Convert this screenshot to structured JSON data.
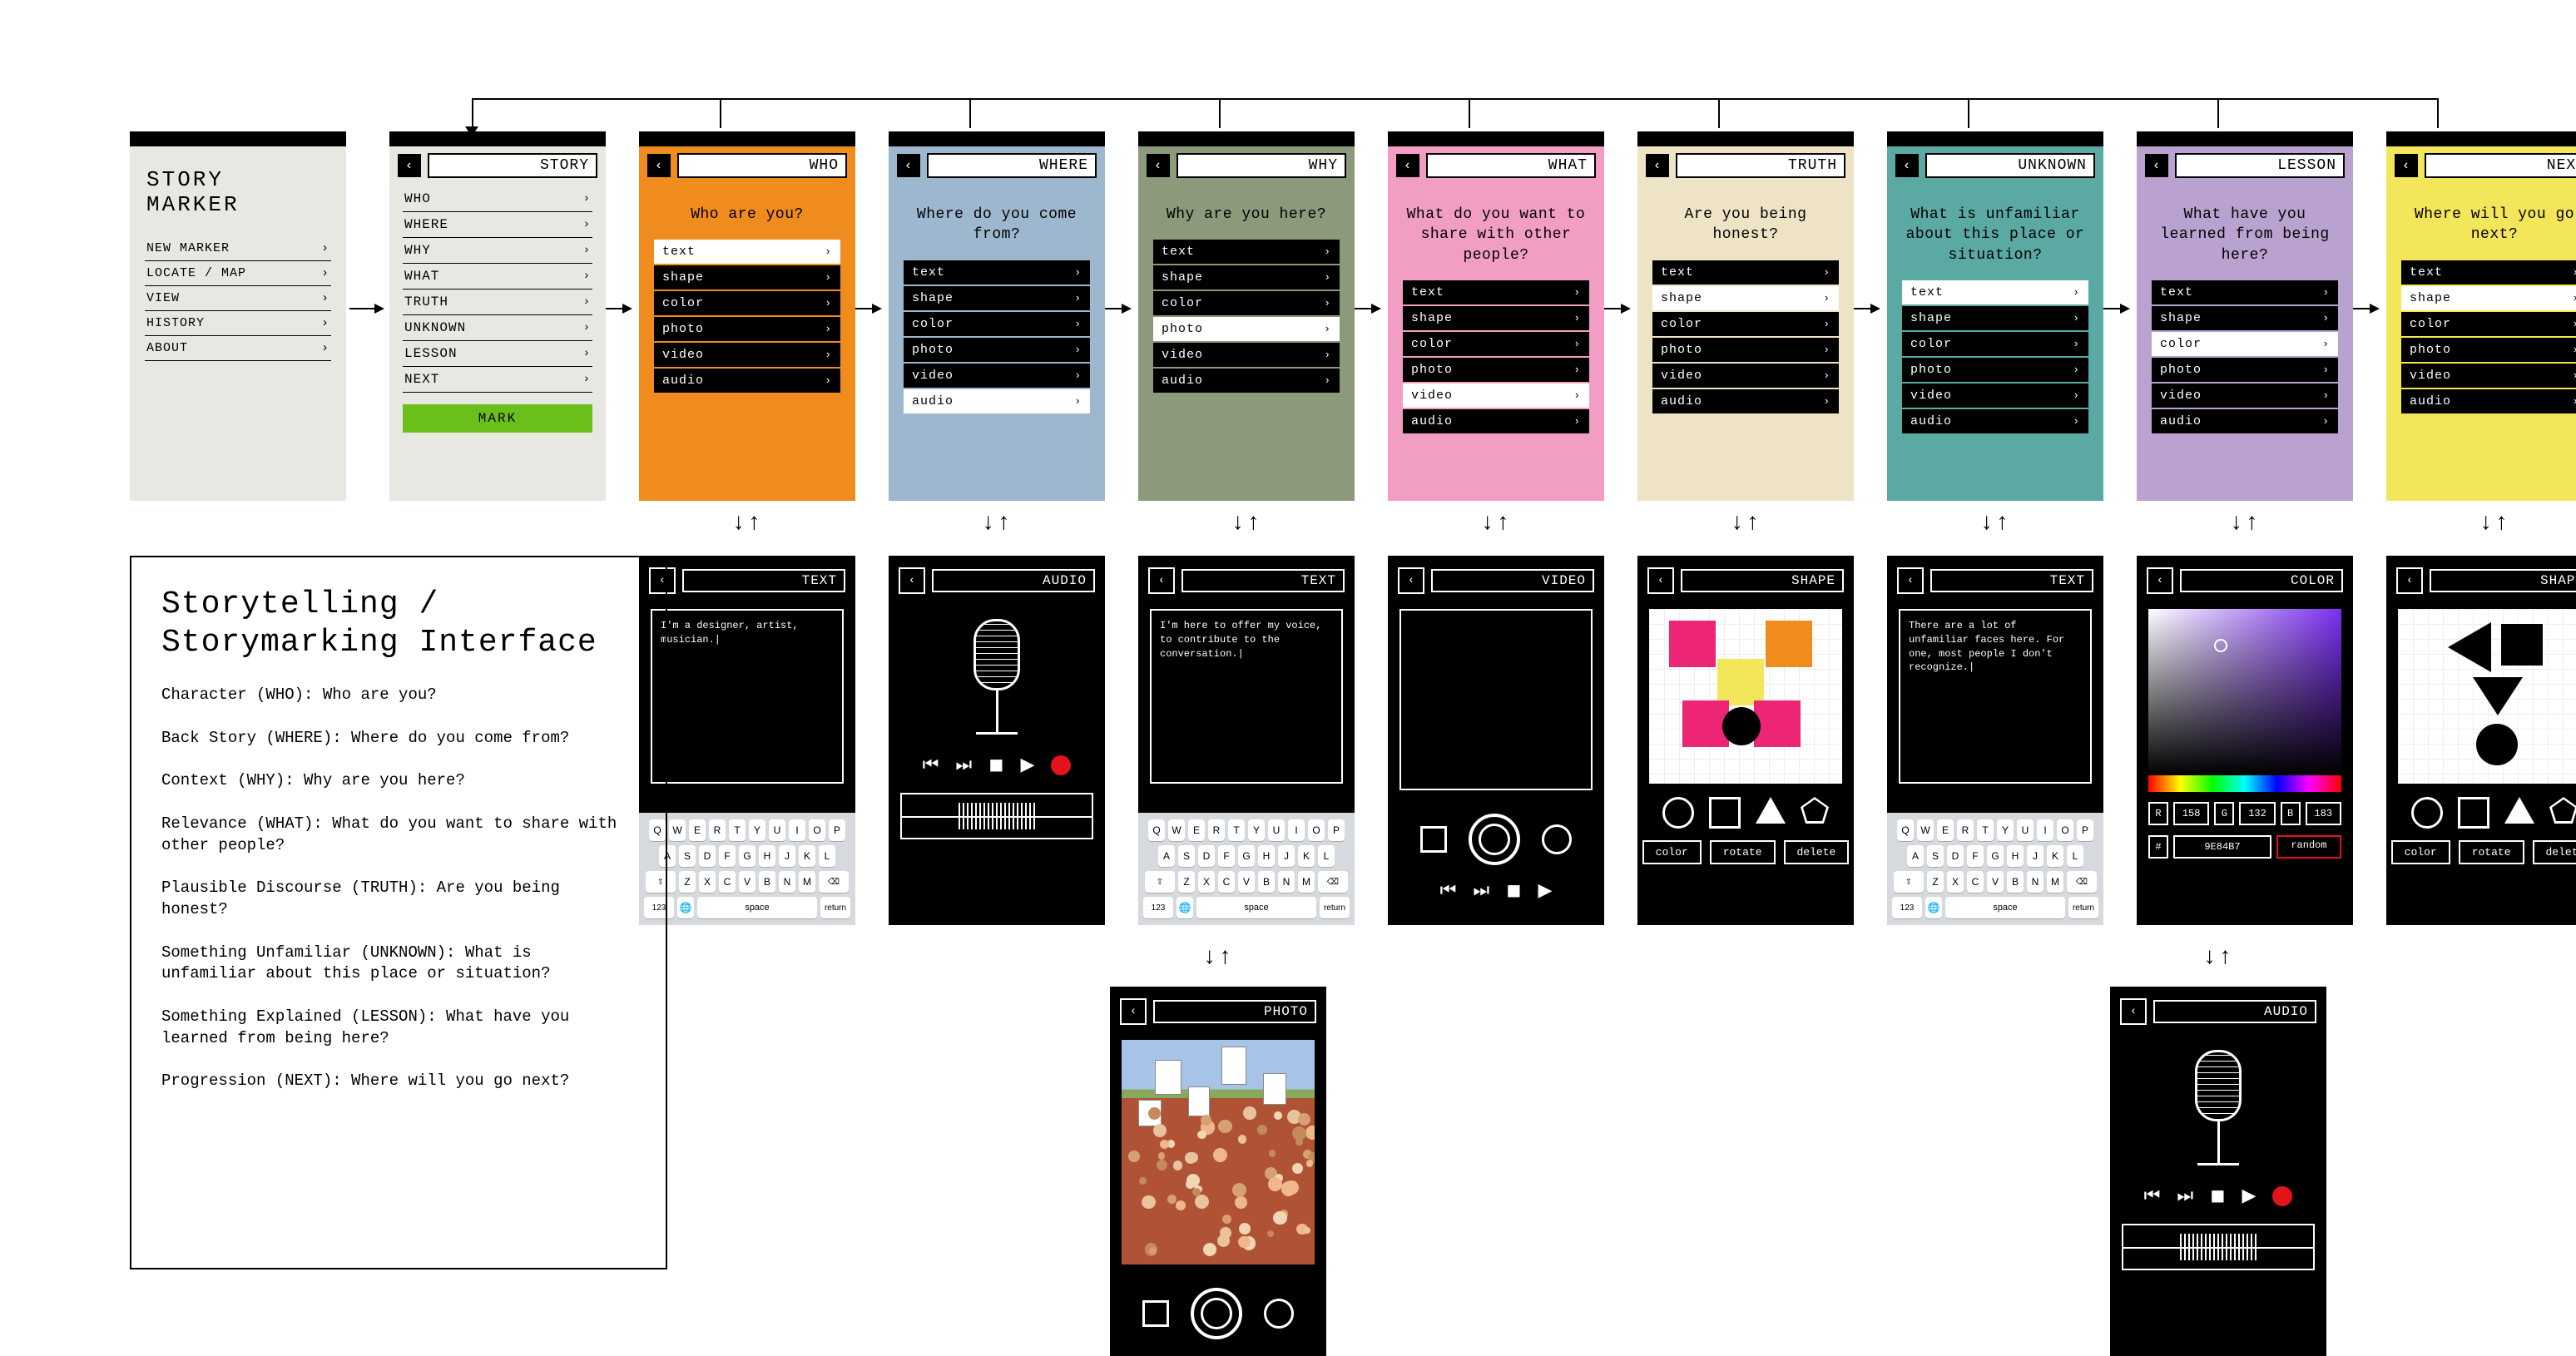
{
  "app": {
    "title_line1": "STORY",
    "title_line2": "MARKER"
  },
  "mainMenu": [
    "NEW MARKER",
    "LOCATE / MAP",
    "VIEW",
    "HISTORY",
    "ABOUT"
  ],
  "storyScreen": {
    "title": "STORY",
    "items": [
      "WHO",
      "WHERE",
      "WHY",
      "WHAT",
      "TRUTH",
      "UNKNOWN",
      "LESSON",
      "NEXT"
    ],
    "mark": "MARK"
  },
  "mediaOptions": [
    "text",
    "shape",
    "color",
    "photo",
    "video",
    "audio"
  ],
  "questions": [
    {
      "key": "WHO",
      "title": "WHO",
      "q": "Who are you?",
      "bg": "#f08b1d",
      "hi": 0
    },
    {
      "key": "WHERE",
      "title": "WHERE",
      "q": "Where do you come from?",
      "bg": "#9db7cf",
      "hi": 5
    },
    {
      "key": "WHY",
      "title": "WHY",
      "q": "Why are you here?",
      "bg": "#8a9a7b",
      "hi": 3
    },
    {
      "key": "WHAT",
      "title": "WHAT",
      "q": "What do you want to share with other people?",
      "bg": "#f29ec4",
      "hi": 4
    },
    {
      "key": "TRUTH",
      "title": "TRUTH",
      "q": "Are you being honest?",
      "bg": "#eee3c4",
      "hi": 1
    },
    {
      "key": "UNKNOWN",
      "title": "UNKNOWN",
      "q": "What is unfamiliar about this place or situation?",
      "bg": "#5aa9a3",
      "hi": 0
    },
    {
      "key": "LESSON",
      "title": "LESSON",
      "q": "What have you learned from being here?",
      "bg": "#b9a2cf",
      "hi": 2
    },
    {
      "key": "NEXT",
      "title": "NEXT",
      "q": "Where will you go next?",
      "bg": "#f4e65a",
      "hi": 1
    }
  ],
  "detail": {
    "text_who": {
      "title": "TEXT",
      "body": "I'm a designer, artist, musician.|"
    },
    "audio": {
      "title": "AUDIO"
    },
    "text_why": {
      "title": "TEXT",
      "body": "I'm here to offer my voice, to contribute to the conversation.|"
    },
    "video": {
      "title": "VIDEO"
    },
    "shape": {
      "title": "SHAPE",
      "btns": [
        "color",
        "rotate",
        "delete"
      ]
    },
    "text_unknown": {
      "title": "TEXT",
      "body": "There are a lot of unfamiliar faces here. For one, most people I don't recognize.|"
    },
    "color": {
      "title": "COLOR",
      "r": "158",
      "g": "132",
      "b": "183",
      "hex": "9E84B7",
      "random": "random"
    },
    "shape_next": {
      "title": "SHAPE",
      "btns": [
        "color",
        "rotate",
        "delete"
      ]
    },
    "photo": {
      "title": "PHOTO"
    },
    "audio2": {
      "title": "AUDIO"
    }
  },
  "keyboard": {
    "r1": [
      "Q",
      "W",
      "E",
      "R",
      "T",
      "Y",
      "U",
      "I",
      "O",
      "P"
    ],
    "r2": [
      "A",
      "S",
      "D",
      "F",
      "G",
      "H",
      "J",
      "K",
      "L"
    ],
    "r3": [
      "Z",
      "X",
      "C",
      "V",
      "B",
      "N",
      "M"
    ],
    "bottom": {
      "num": "123",
      "globe": "🌐",
      "space": "space",
      "ret": "return"
    }
  },
  "desc": {
    "title": "Storytelling / Storymarking Interface",
    "lines": [
      "Character (WHO):  Who are you?",
      "Back Story (WHERE): Where do you come from?",
      "Context (WHY): Why are you here?",
      "Relevance (WHAT): What do you want to share with other people?",
      "Plausible Discourse (TRUTH): Are you being honest?",
      "Something Unfamiliar (UNKNOWN): What is unfamiliar about this place or situation?",
      "Something Explained (LESSON): What have you learned from being here?",
      "Progression (NEXT): Where will you go next?"
    ]
  },
  "icons": {
    "chev": "›",
    "back": "‹",
    "prev": "⏮",
    "next": "⏭",
    "stop": "◼",
    "play": "▶"
  }
}
